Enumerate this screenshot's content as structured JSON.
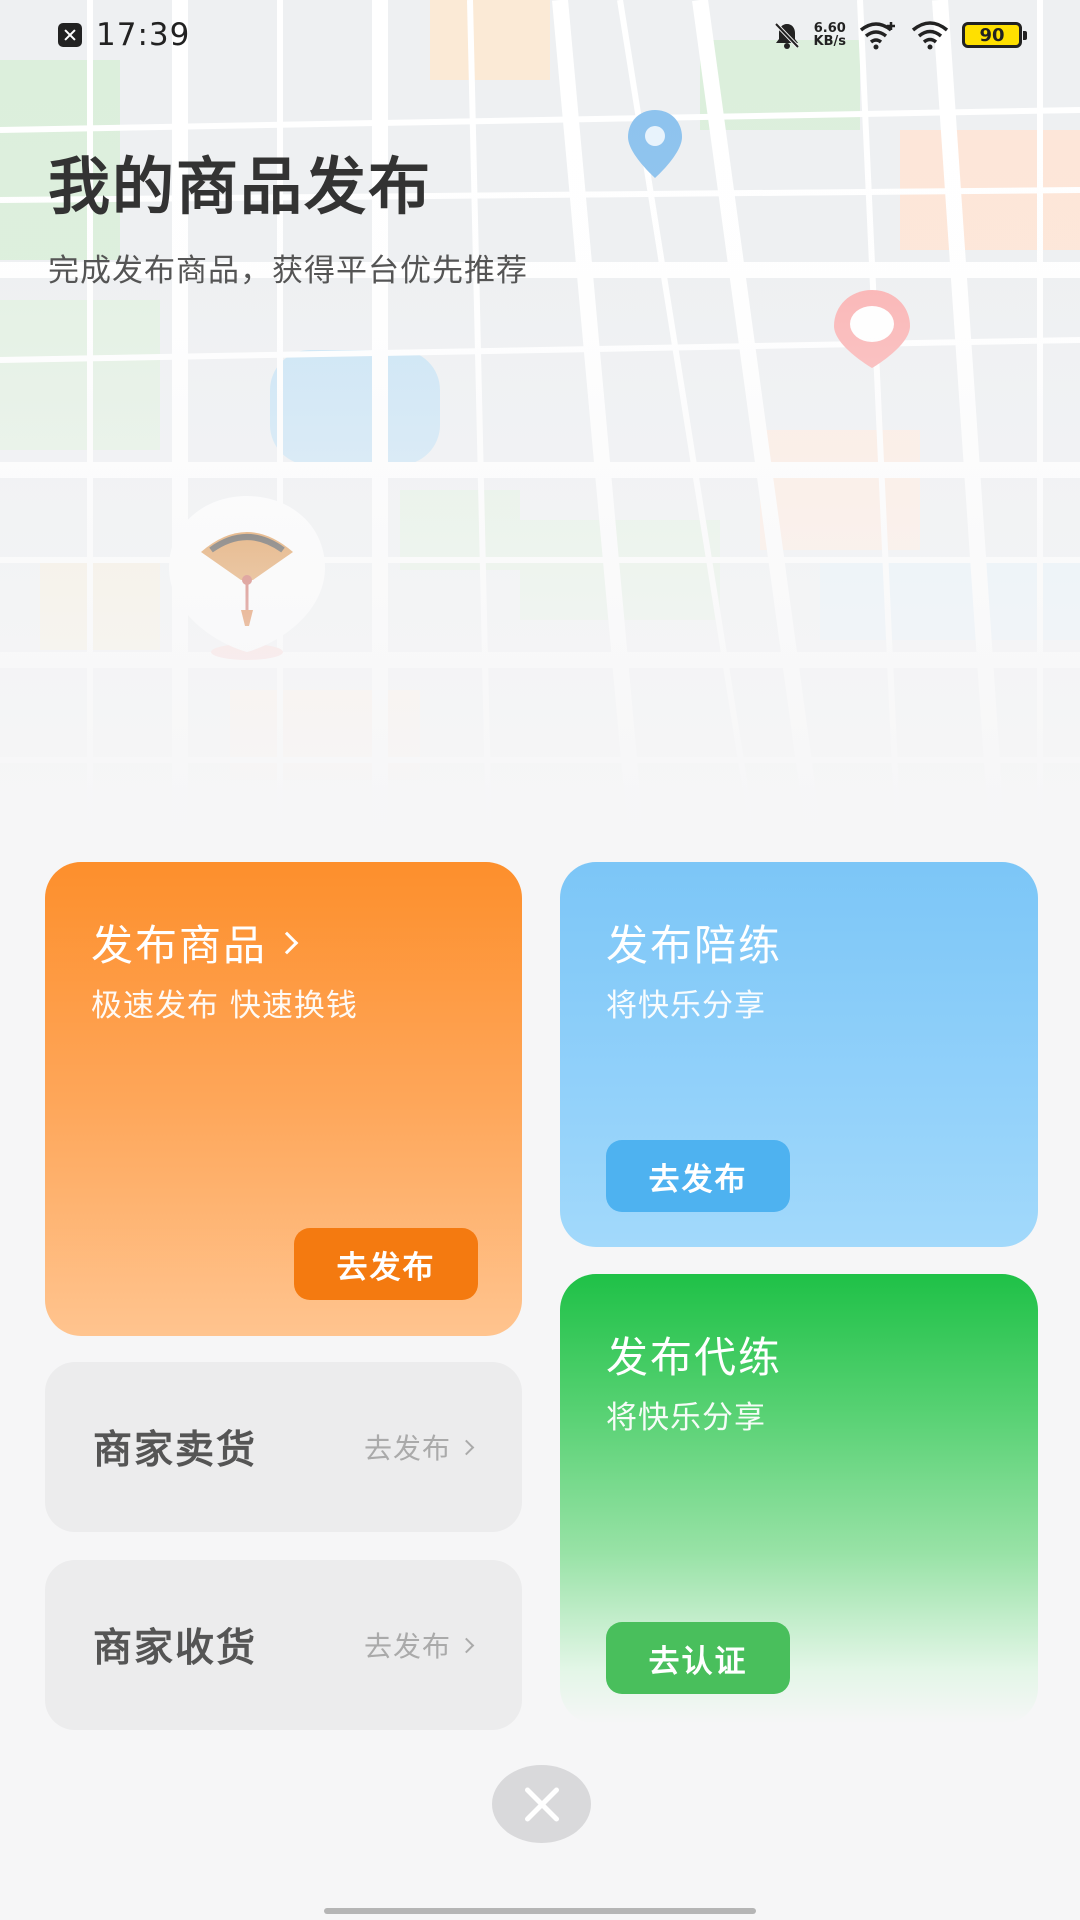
{
  "status_bar": {
    "time": "17:39",
    "net_speed_value": "6.60",
    "net_speed_unit": "KB/s",
    "battery": "90"
  },
  "header": {
    "title": "我的商品发布",
    "subtitle": "完成发布商品，获得平台优先推荐"
  },
  "cards": {
    "goods": {
      "title": "发布商品",
      "desc": "极速发布 快速换钱",
      "button": "去发布",
      "color": "#fd8f2c"
    },
    "peilian": {
      "title": "发布陪练",
      "desc": "将快乐分享",
      "button": "去发布",
      "color": "#7cc6f7"
    },
    "dailian": {
      "title": "发布代练",
      "desc": "将快乐分享",
      "button": "去认证",
      "color": "#1fc147"
    }
  },
  "merchant": {
    "sell": {
      "label": "商家卖货",
      "action": "去发布"
    },
    "buy": {
      "label": "商家收货",
      "action": "去发布"
    }
  },
  "icons": {
    "close": "close-icon",
    "map_pin_blue": "map-pin-icon",
    "map_pin_red": "map-pin-icon",
    "fan": "folding-fan-icon"
  }
}
